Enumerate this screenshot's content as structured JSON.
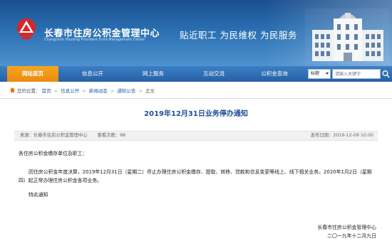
{
  "header": {
    "site_title": "长春市住房公积金管理中心",
    "site_subtitle": "Changchun Housing Provident Fund Management Center",
    "slogan": "贴近职工  为民维权  为民服务",
    "colors": {
      "header_blue": "#1f5d9e",
      "nav_active_orange": "#ec8a0f",
      "title_blue": "#1f4f94"
    }
  },
  "nav": {
    "items": [
      {
        "label": "网站首页",
        "active": true
      },
      {
        "label": "信息公开"
      },
      {
        "label": "网上服务"
      },
      {
        "label": "互动交流"
      },
      {
        "label": "公积金查询"
      }
    ],
    "search": {
      "select_value": "标题",
      "placeholder": "请输入关键字",
      "button_icon": "search-icon"
    }
  },
  "breadcrumb": {
    "prefix": "您的位置：",
    "items": [
      "首页",
      "信息公开",
      "新闻动态",
      "通知公告",
      "正文"
    ],
    "separator": ">"
  },
  "article": {
    "title": "2019年12月31日业务停办通知",
    "meta": {
      "source_label": "来源：",
      "source": "长春市住房公积金管理中心",
      "views_label": "查看次数：",
      "views": "98",
      "published_label": "发布日期：",
      "published": "2019-12-09 10:00"
    },
    "greeting": "各住房公积金缴存单位及职工：",
    "paragraph_1": "因住房公积金年度决算，2019年12月31日（星期二）停止办理住房公积金缴存、提取、转移、贷款和信息变更等线上、线下相关业务。2020年1月2日（星期四）起正常办理住房公积金各项业务。",
    "paragraph_2": "特此通知",
    "signature_org": "长春市住房公积金管理中心",
    "signature_date": "二〇一九年十二月九日"
  }
}
